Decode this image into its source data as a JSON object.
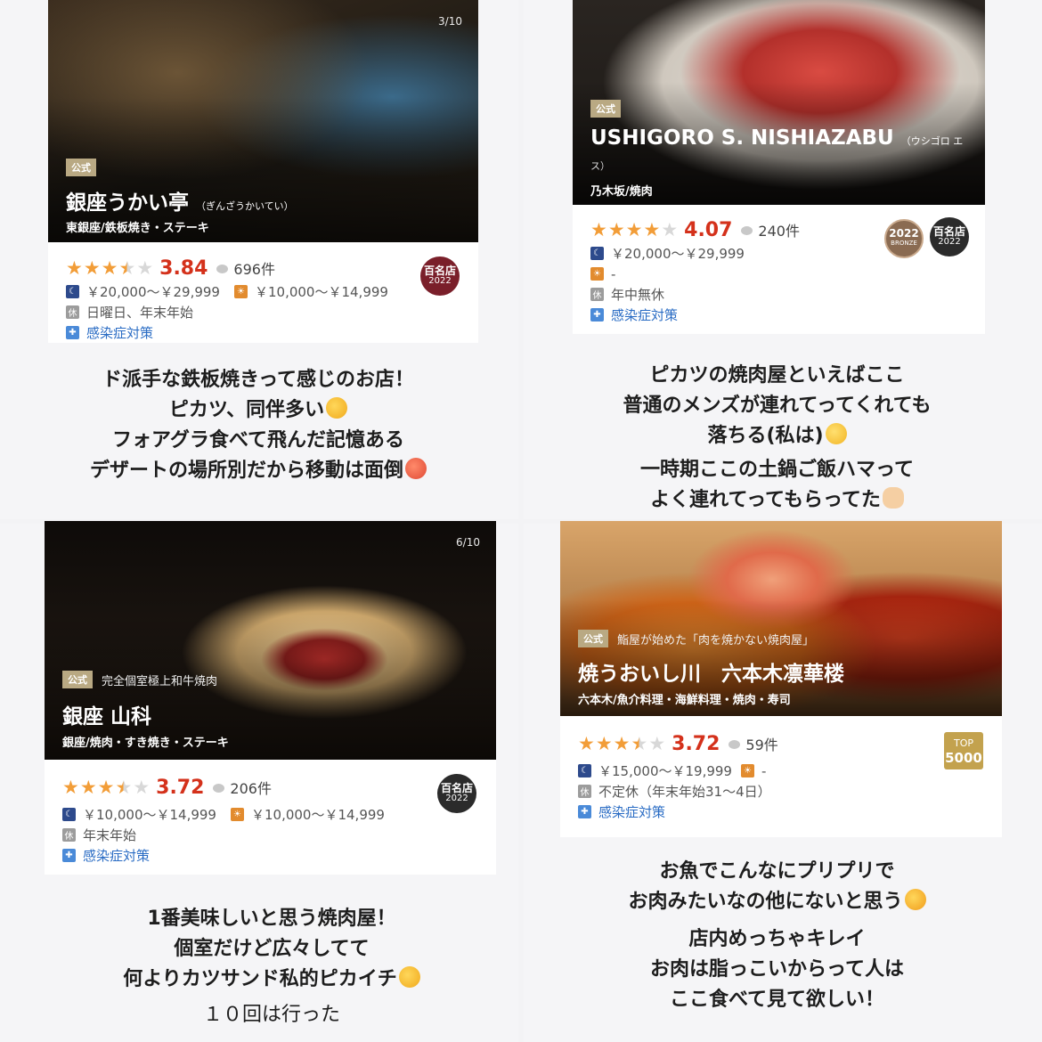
{
  "cards": [
    {
      "counter": "3/10",
      "tag": "公式",
      "subtitle": "",
      "title": "銀座うかい亭",
      "ruby": "（ぎんざうかいてい）",
      "area": "東銀座/鉄板焼き・ステーキ",
      "stars": 3.5,
      "score": "3.84",
      "reviews": "696件",
      "dinner": "￥20,000～￥29,999",
      "lunch": "￥10,000～￥14,999",
      "closed_icon": "休",
      "closed": "日曜日、年末年始",
      "covid": "感染症対策",
      "badge_top": "百名店",
      "badge_year": "2022",
      "comment": [
        "ド派手な鉄板焼きって感じのお店！",
        "ピカツ、同伴多い",
        "フォアグラ食べて飛んだ記憶ある",
        "デザートの場所別だから移動は面倒"
      ]
    },
    {
      "counter": "",
      "tag": "公式",
      "subtitle": "",
      "title": "USHIGORO S. NISHIAZABU",
      "ruby": "（ウシゴロ エ",
      "ruby2": "ス）",
      "area": "乃木坂/焼肉",
      "stars": 4,
      "score": "4.07",
      "reviews": "240件",
      "dinner": "￥20,000～￥29,999",
      "lunch": "-",
      "closed_icon": "休",
      "closed": "年中無休",
      "covid": "感染症対策",
      "bronze_year": "2022",
      "bronze_label": "BRONZE",
      "badge_top": "百名店",
      "badge_year": "2022",
      "comment": [
        "ピカツの焼肉屋といえばここ",
        "普通のメンズが連れてってくれても",
        "落ちる(私は)",
        "一時期ここの土鍋ご飯ハマって",
        "よく連れてってもらってた"
      ]
    },
    {
      "counter": "6/10",
      "tag": "公式",
      "subtitle": "完全個室極上和牛焼肉",
      "title": "銀座 山科",
      "ruby": "",
      "area": "銀座/焼肉・すき焼き・ステーキ",
      "stars": 3.5,
      "score": "3.72",
      "reviews": "206件",
      "dinner": "￥10,000～￥14,999",
      "lunch": "￥10,000～￥14,999",
      "closed_icon": "休",
      "closed": "年末年始",
      "covid": "感染症対策",
      "badge_top": "百名店",
      "badge_year": "2022",
      "comment": [
        "1番美味しいと思う焼肉屋！",
        "個室だけど広々してて",
        "何よりカツサンド私的ピカイチ",
        "１０回は行った"
      ]
    },
    {
      "counter": "",
      "tag": "公式",
      "subtitle": "鮨屋が始めた「肉を焼かない焼肉屋」",
      "title": "焼うおいし川　六本木凛華楼",
      "ruby": "",
      "area": "六本木/魚介料理・海鮮料理・焼肉・寿司",
      "stars": 3.5,
      "score": "3.72",
      "reviews": "59件",
      "dinner": "￥15,000～￥19,999",
      "lunch": "-",
      "closed_icon": "休",
      "closed": "不定休（年末年始31～4日）",
      "covid": "感染症対策",
      "top_label": "TOP",
      "top_value": "5000",
      "comment": [
        "お魚でこんなにプリプリで",
        "お肉みたいなの他にないと思う",
        "店内めっちゃキレイ",
        "お肉は脂っこいからって人は",
        "ここ食べて見て欲しい！"
      ]
    }
  ],
  "colors": {
    "star": "#f29d38",
    "score": "#d4311b",
    "tag": "#b9a983",
    "link": "#2a6cc4"
  }
}
